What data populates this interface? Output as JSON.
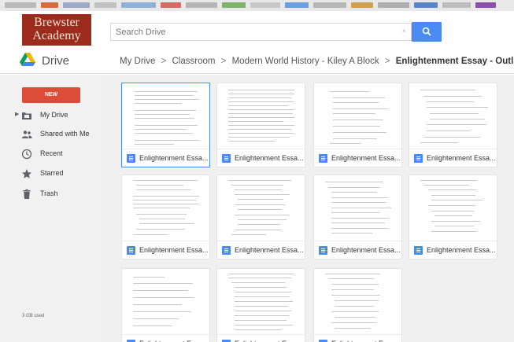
{
  "header": {
    "logo_line1": "Brewster",
    "logo_line2": "Academy",
    "search_placeholder": "Search Drive",
    "search_clear": "×",
    "search_button_icon": "search-icon"
  },
  "titlebar": {
    "app_name": "Drive",
    "breadcrumbs": [
      "My Drive",
      "Classroom",
      "Modern World History - Kiley A Block",
      "Enlightenment Essay - Outline"
    ],
    "separator": ">",
    "dropdown_icon": "▾"
  },
  "sidebar": {
    "new_label": "NEW",
    "items": [
      {
        "label": "My Drive",
        "icon": "folder-icon"
      },
      {
        "label": "Shared with Me",
        "icon": "people-icon"
      },
      {
        "label": "Recent",
        "icon": "clock-icon"
      },
      {
        "label": "Starred",
        "icon": "star-icon"
      },
      {
        "label": "Trash",
        "icon": "trash-icon"
      }
    ],
    "storage_text": "3 GB used"
  },
  "files": [
    {
      "name": "Enlightenment Essa..."
    },
    {
      "name": "Enlightenment Essa..."
    },
    {
      "name": "Enlightenment Essa..."
    },
    {
      "name": "Enlightenment Essa..."
    },
    {
      "name": "Enlightenment Essa..."
    },
    {
      "name": "Enlightenment Essa..."
    },
    {
      "name": "Enlightenment Essa..."
    },
    {
      "name": "Enlightenment Essa..."
    },
    {
      "name": "Enlightenment Essa..."
    },
    {
      "name": "Enlightenment Essa..."
    },
    {
      "name": "Enlightenment Essa..."
    }
  ],
  "colors": {
    "accent": "#4a8af4",
    "new_button": "#dd4b39",
    "logo_bg": "#9c2b1e"
  }
}
